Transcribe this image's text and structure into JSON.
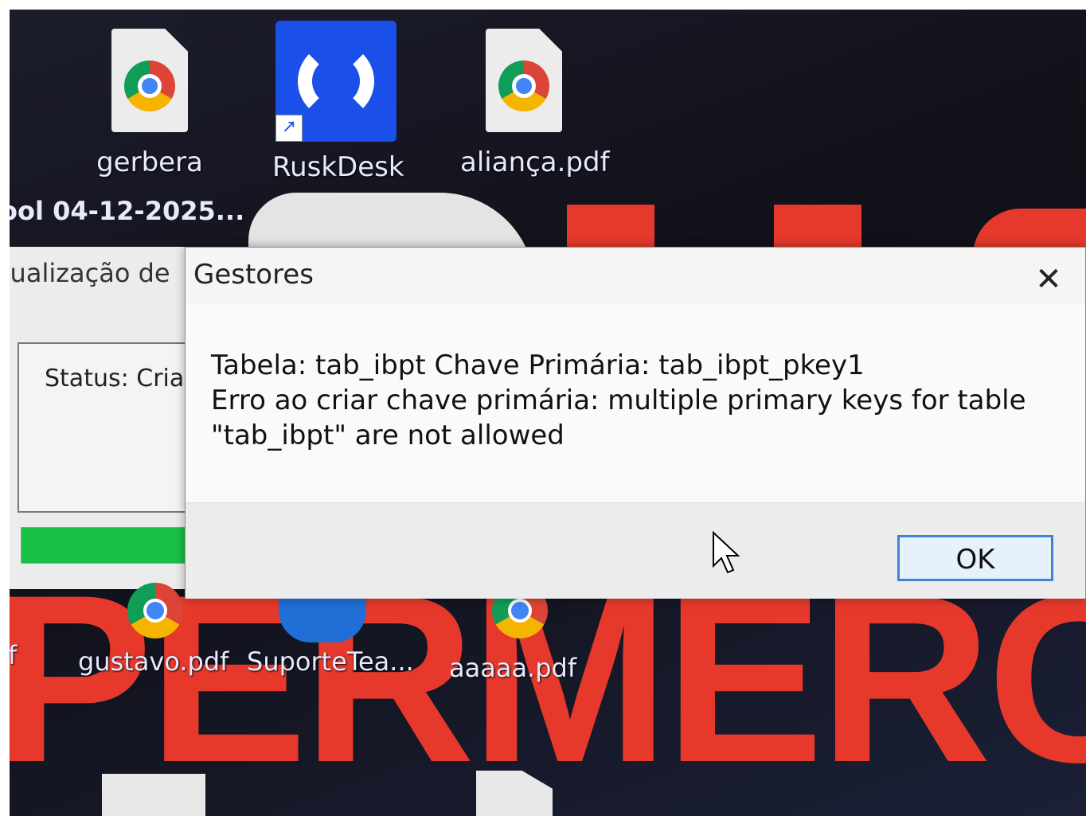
{
  "desktop": {
    "icons_top": [
      {
        "label": "gerbera",
        "icon": "chrome-pdf-icon"
      },
      {
        "label": "RuskDesk",
        "icon": "ruskdesk-icon"
      },
      {
        "label": "aliança.pdf",
        "icon": "chrome-pdf-icon"
      }
    ],
    "partial_label": "ool  04-12-2025...",
    "icons_bottom": [
      {
        "label": "gustavo.pdf",
        "icon": "chrome-pdf-icon"
      },
      {
        "label": "SuporteTea...",
        "icon": "teamviewer-icon"
      },
      {
        "label": "aaaaa.pdf",
        "icon": "chrome-pdf-icon"
      }
    ],
    "wallpaper_text": "PERMERCA",
    "left_edge_letter": "f"
  },
  "background_window": {
    "title": "tualização de",
    "status_label": "Status:",
    "status_value": "Criar",
    "progress_fraction": 0.9
  },
  "dialog": {
    "title": "Gestores",
    "close_glyph": "✕",
    "message": "Tabela: tab_ibpt Chave Primária: tab_ibpt_pkey1\nErro ao criar chave primária: multiple primary keys for table \"tab_ibpt\" are not allowed",
    "ok_label": "OK"
  },
  "colors": {
    "wallpaper_red": "#e6392b",
    "progress_green": "#18c045",
    "ok_border": "#3c82d6",
    "ruskdesk_blue": "#1a4fe8"
  }
}
